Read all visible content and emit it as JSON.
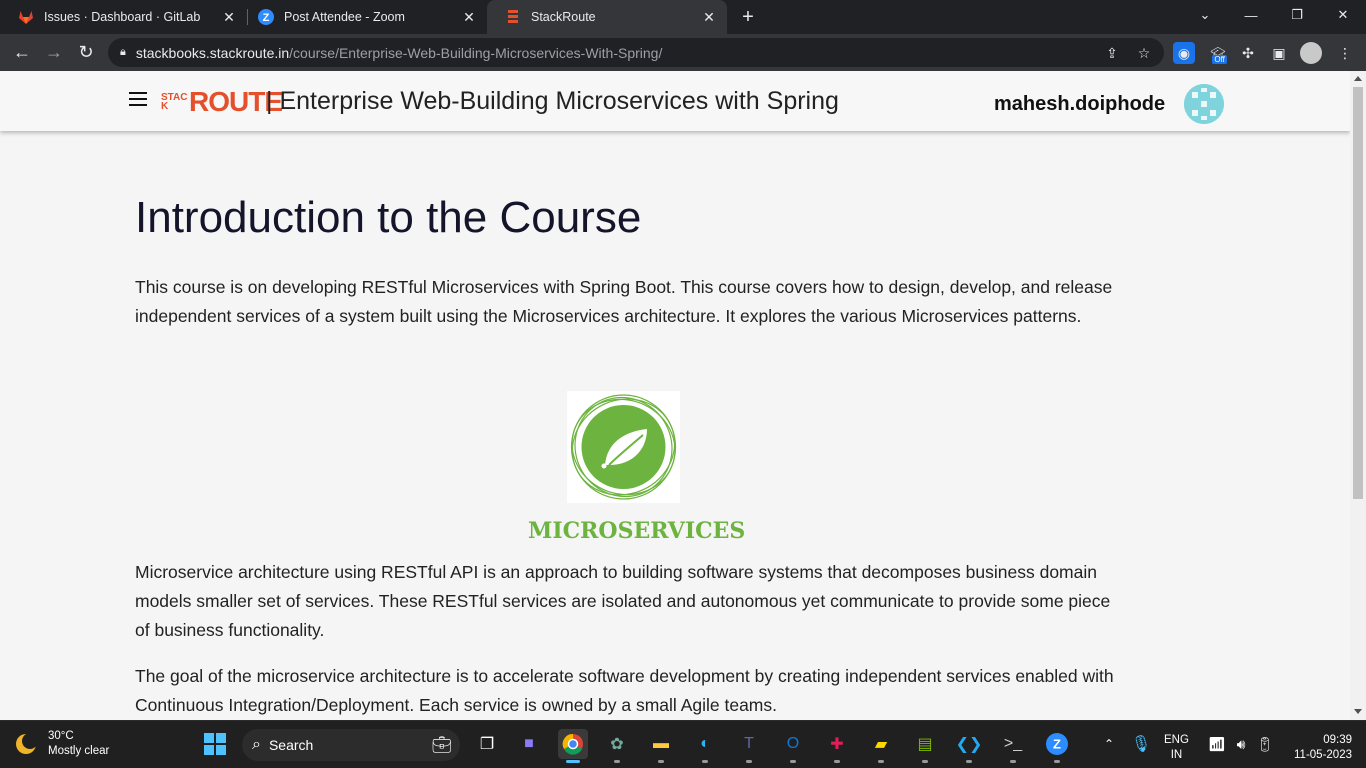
{
  "browser": {
    "tabs": [
      {
        "title": "Issues · Dashboard · GitLab",
        "icon": "gitlab-icon",
        "active": false
      },
      {
        "title": "Post Attendee - Zoom",
        "icon": "zoom-icon",
        "active": false
      },
      {
        "title": "StackRoute",
        "icon": "stackroute-icon",
        "active": true
      }
    ],
    "url_host": "stackbooks.stackroute.in",
    "url_path": "/course/Enterprise-Web-Building-Microservices-With-Spring/",
    "extension_badge": "Off"
  },
  "header": {
    "logo_stack": "STACK",
    "logo_route": "ROUTE",
    "course_title": "| Enterprise Web-Building Microservices with Spring",
    "username": "mahesh.doiphode"
  },
  "content": {
    "heading": "Introduction to the Course",
    "intro": "This course is on developing RESTful Microservices with Spring Boot. This course covers how to design, develop, and release independent services of a system built using the Microservices architecture. It explores the various Microservices patterns.",
    "image_caption": "MICROSERVICES",
    "para2": "Microservice architecture using RESTful API is an approach to building software systems that decomposes business domain models smaller set of services. These RESTful services are isolated and autonomous yet communicate to provide some piece of business functionality.",
    "para3": "The goal of the microservice architecture is to accelerate software development by creating independent services enabled with Continuous Integration/Deployment. Each service is owned by a small Agile teams."
  },
  "colors": {
    "brand": "#e4502c",
    "spring_green": "#6db33f",
    "heading": "#14142b"
  },
  "taskbar": {
    "weather_temp": "30°C",
    "weather_desc": "Mostly clear",
    "search_label": "Search",
    "lang_top": "ENG",
    "lang_bottom": "IN",
    "time": "09:39",
    "date": "11-05-2023"
  }
}
